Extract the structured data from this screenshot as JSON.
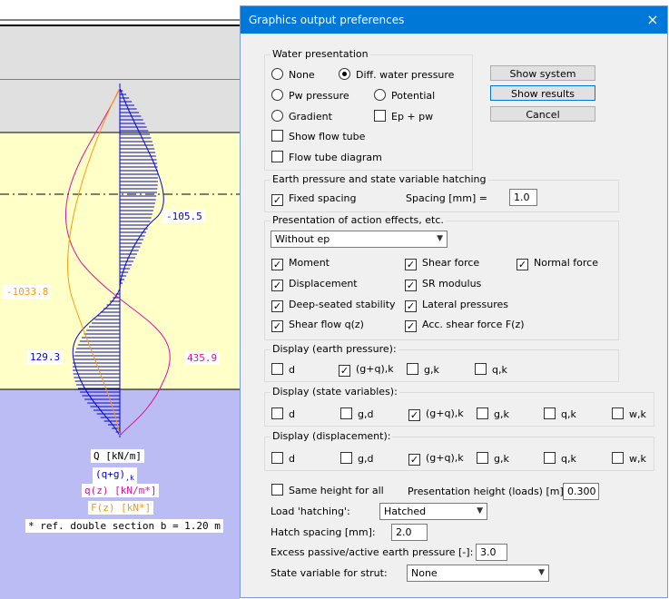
{
  "background": {
    "labels": {
      "v_105": "-105.5",
      "v_1033": "-1033.8",
      "v_129": "129.3",
      "v_435": "435.9"
    },
    "legend": {
      "q": "Q  [kN/m]",
      "gq_main": "(q+g)",
      "gq_sub": ",k",
      "qz": "q(z) [kN/m*]",
      "fz": "F(z) [kN*]",
      "ref": "* ref. double section b = 1.20 m"
    },
    "colors": {
      "blue": "#0000e0",
      "magenta": "#e0109c",
      "orange": "#ff9a00",
      "soil_yellow": "#ffffc8",
      "soil_lavender": "#bcbcf4",
      "grey": "#e0e0e0"
    }
  },
  "dialog": {
    "title": "Graphics output preferences",
    "close_icon": "×",
    "buttons": {
      "show_system": "Show system",
      "show_results": "Show results",
      "cancel": "Cancel"
    },
    "water": {
      "label": "Water presentation",
      "none": "None",
      "diff": "Diff. water pressure",
      "pw": "Pw pressure",
      "potential": "Potential",
      "gradient": "Gradient",
      "ep_pw": "Ep + pw",
      "show_flow": "Show flow tube",
      "flow_diagram": "Flow tube diagram"
    },
    "earth_hatch": {
      "label": "Earth pressure and state variable hatching",
      "fixed": "Fixed spacing",
      "spacing_label": "Spacing [mm] =",
      "spacing_value": "1.0"
    },
    "action": {
      "label": "Presentation of action effects, etc.",
      "select": "Without ep",
      "moment": "Moment",
      "shear": "Shear force",
      "normal": "Normal force",
      "displacement": "Displacement",
      "sr": "SR modulus",
      "deep": "Deep-seated stability",
      "lateral": "Lateral pressures",
      "shearflow": "Shear flow q(z)",
      "accshear": "Acc. shear force F(z)"
    },
    "disp_ep": {
      "label": "Display (earth pressure):",
      "d": "d",
      "gqk": "(g+q),k",
      "gk": "g,k",
      "qk": "q,k"
    },
    "disp_sv": {
      "label": "Display (state variables):",
      "d": "d",
      "gd": "g,d",
      "gqk": "(g+q),k",
      "gk": "g,k",
      "qk": "q,k",
      "wk": "w,k"
    },
    "disp_dp": {
      "label": "Display (displacement):",
      "d": "d",
      "gd": "g,d",
      "gqk": "(g+q),k",
      "gk": "g,k",
      "qk": "q,k",
      "wk": "w,k"
    },
    "bottom": {
      "same_height": "Same height for all",
      "pres_height_label": "Presentation height (loads) [m]:",
      "pres_height_value": "0.300",
      "load_hatch_label": "Load 'hatching':",
      "load_hatch_value": "Hatched",
      "hatch_spacing_label": "Hatch spacing [mm]:",
      "hatch_spacing_value": "2.0",
      "excess_label": "Excess passive/active earth pressure [-]:",
      "excess_value": "3.0",
      "strut_label": "State variable for strut:",
      "strut_value": "None"
    }
  }
}
